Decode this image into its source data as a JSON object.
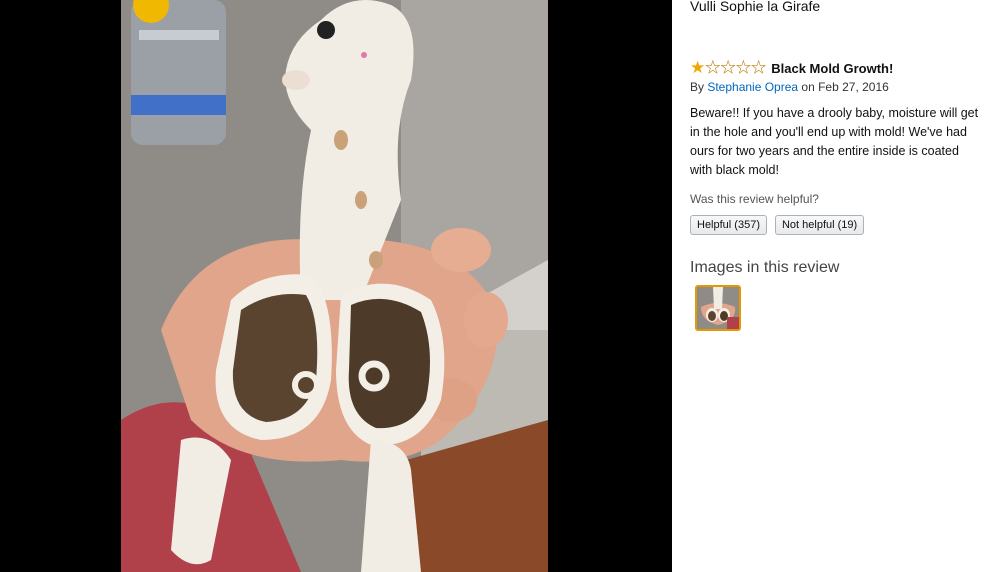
{
  "product": {
    "title": "Vulli Sophie la Girafe"
  },
  "review": {
    "rating": 1,
    "rating_max": 5,
    "title": "Black Mold Growth!",
    "by_prefix": "By ",
    "author": "Stephanie Oprea",
    "date_text": " on Feb 27, 2016",
    "body": "Beware!! If you have a drooly baby, moisture will get in the hole and you'll end up with mold! We've had ours for two years and the entire inside is coated with black mold!"
  },
  "helpful": {
    "question": "Was this review helpful?",
    "helpful_label": "Helpful (357)",
    "not_helpful_label": "Not helpful (19)"
  },
  "images_section": {
    "heading": "Images in this review"
  },
  "colors": {
    "star": "#f0a500",
    "link": "#0066c0",
    "thumb_border": "#e59900"
  }
}
